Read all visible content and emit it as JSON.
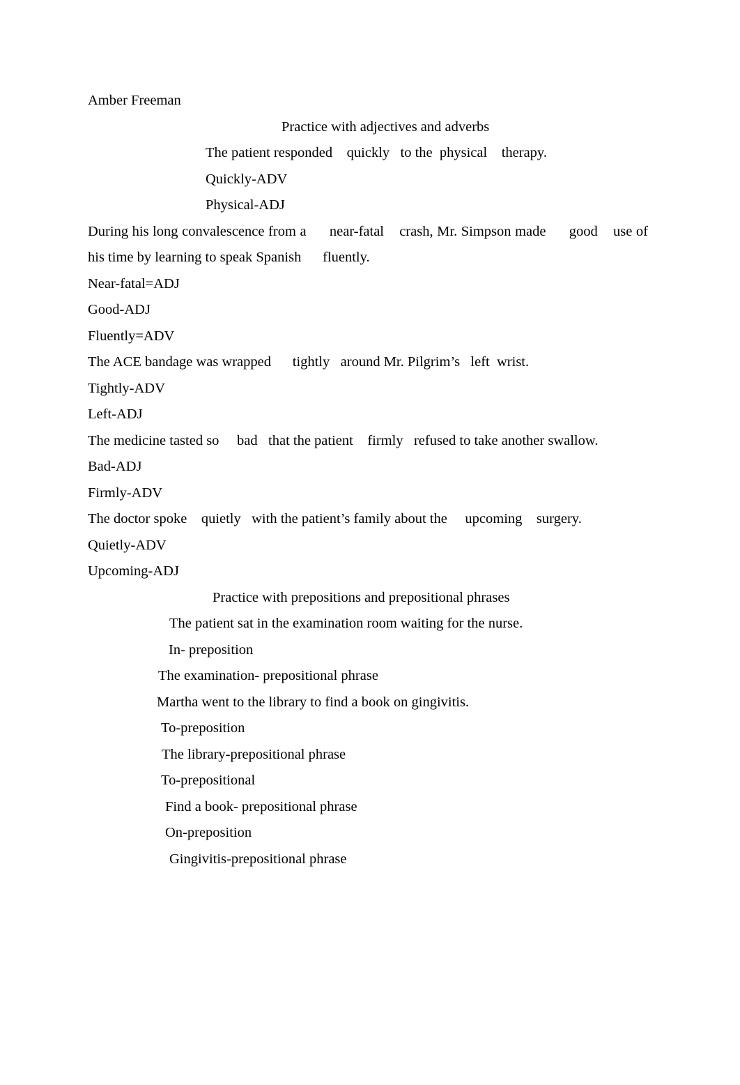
{
  "document": {
    "author_line": "Amber Freeman",
    "sections": [
      {
        "id": "adjectives-adverbs",
        "heading": "Practice with adjectives and adverbs",
        "lines": [
          {
            "id": "sentence-1",
            "text": "The patient responded    quickly   to the  physical    therapy.",
            "indent": "169"
          },
          {
            "id": "answer-1a",
            "text": "Quickly-ADV",
            "indent": "169"
          },
          {
            "id": "answer-1b",
            "text": "Physical-ADJ",
            "indent": "169"
          },
          {
            "id": "sentence-2",
            "text": "During his long convalescence from a      near-fatal    crash, Mr. Simpson made      good    use of his time by learning to speak Spanish      fluently.",
            "indent": "0",
            "justify": true
          },
          {
            "id": "answer-2a",
            "text": "Near-fatal=ADJ",
            "indent": "0"
          },
          {
            "id": "answer-2b",
            "text": "Good-ADJ",
            "indent": "0"
          },
          {
            "id": "answer-2c",
            "text": "Fluently=ADV",
            "indent": "0"
          },
          {
            "id": "sentence-3",
            "text": "The ACE bandage was wrapped      tightly   around Mr. Pilgrim’s   left  wrist.",
            "indent": "0"
          },
          {
            "id": "answer-3a",
            "text": "Tightly-ADV",
            "indent": "0"
          },
          {
            "id": "answer-3b",
            "text": "Left-ADJ",
            "indent": "0"
          },
          {
            "id": "sentence-4",
            "text": "The medicine tasted so     bad   that the patient    firmly   refused to take another swallow.",
            "indent": "0"
          },
          {
            "id": "answer-4a",
            "text": "Bad-ADJ",
            "indent": "0"
          },
          {
            "id": "answer-4b",
            "text": "Firmly-ADV",
            "indent": "0"
          },
          {
            "id": "sentence-5",
            "text": "The doctor spoke    quietly   with the patient’s family about the     upcoming    surgery.",
            "indent": "0"
          },
          {
            "id": "answer-5a",
            "text": "Quietly-ADV",
            "indent": "0"
          },
          {
            "id": "answer-5b",
            "text": "Upcoming-ADJ",
            "indent": "0"
          }
        ]
      },
      {
        "id": "prepositions",
        "heading": "Practice with prepositions and prepositional phrases",
        "lines": [
          {
            "id": "prep-sentence-1",
            "text": "The patient sat in the examination room waiting for the nurse.",
            "indent": "117"
          },
          {
            "id": "prep-answer-1a",
            "text": "In- preposition",
            "indent": "116"
          },
          {
            "id": "prep-answer-1b",
            "text": "The examination- prepositional phrase",
            "indent": "101"
          },
          {
            "id": "prep-sentence-2",
            "text": "Martha went to the library to find a book on gingivitis.",
            "indent": "99"
          },
          {
            "id": "prep-answer-2a",
            "text": "To-preposition",
            "indent": "105"
          },
          {
            "id": "prep-answer-2b",
            "text": "The library-prepositional phrase",
            "indent": "106"
          },
          {
            "id": "prep-answer-2c",
            "text": "To-prepositional",
            "indent": "105"
          },
          {
            "id": "prep-answer-2d",
            "text": "Find a book- prepositional phrase",
            "indent": "111"
          },
          {
            "id": "prep-answer-2e",
            "text": "On-preposition",
            "indent": "111"
          },
          {
            "id": "prep-answer-2f",
            "text": "Gingivitis-prepositional phrase",
            "indent": "117"
          }
        ]
      }
    ]
  },
  "style": {
    "text_color": "#000000",
    "page_background": "#ffffff"
  }
}
